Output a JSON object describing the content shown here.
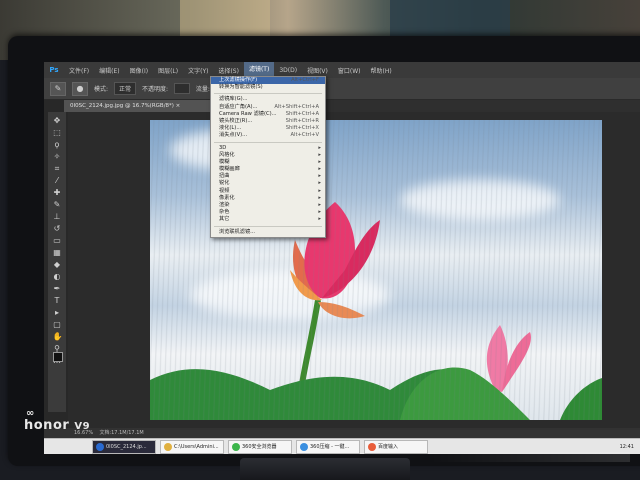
{
  "app": {
    "logo": "Ps"
  },
  "menubar": {
    "items": [
      "文件(F)",
      "编辑(E)",
      "图像(I)",
      "图层(L)",
      "文字(Y)",
      "选择(S)",
      "滤镜(T)",
      "3D(D)",
      "视图(V)",
      "窗口(W)",
      "帮助(H)"
    ],
    "active_index": 6
  },
  "options": {
    "mode_label": "模式:",
    "mode_value": "正常",
    "opacity_label": "不透明度:",
    "flow_label": "流量:"
  },
  "document": {
    "tab_label": "0I0SC_2124.jpg.jpg @ 16.7%(RGB/8*) ×"
  },
  "filter_menu": {
    "items": [
      {
        "label": "上次滤镜操作(F)",
        "shortcut": "Alt+Ctrl+F"
      },
      {
        "label": "转换为智能滤镜(S)",
        "shortcut": ""
      },
      {
        "sep": true
      },
      {
        "label": "滤镜库(G)...",
        "shortcut": ""
      },
      {
        "label": "自适应广角(A)...",
        "shortcut": "Alt+Shift+Ctrl+A"
      },
      {
        "label": "Camera Raw 滤镜(C)...",
        "shortcut": "Shift+Ctrl+A"
      },
      {
        "label": "镜头校正(R)...",
        "shortcut": "Shift+Ctrl+R"
      },
      {
        "label": "液化(L)...",
        "shortcut": "Shift+Ctrl+X"
      },
      {
        "label": "消失点(V)...",
        "shortcut": "Alt+Ctrl+V"
      },
      {
        "sep": true
      },
      {
        "label": "3D",
        "arrow": true
      },
      {
        "label": "风格化",
        "arrow": true
      },
      {
        "label": "模糊",
        "arrow": true
      },
      {
        "label": "模糊画廊",
        "arrow": true
      },
      {
        "label": "扭曲",
        "arrow": true
      },
      {
        "label": "锐化",
        "arrow": true
      },
      {
        "label": "视频",
        "arrow": true
      },
      {
        "label": "像素化",
        "arrow": true
      },
      {
        "label": "渲染",
        "arrow": true
      },
      {
        "label": "杂色",
        "arrow": true
      },
      {
        "label": "其它",
        "arrow": true
      },
      {
        "sep": true
      },
      {
        "label": "浏览联机滤镜...",
        "shortcut": ""
      }
    ]
  },
  "status": {
    "zoom": "16.67%",
    "doc_size": "文档:17.1M/17.1M"
  },
  "taskbar": {
    "items": [
      {
        "label": "0I0SC_2124.jp...",
        "color": "#2a6ad0"
      },
      {
        "label": "C:\\Users\\Admini...",
        "color": "#e0b040"
      },
      {
        "label": "360安全浏览器",
        "color": "#3bb54a"
      },
      {
        "label": "360压缩 - 一键...",
        "color": "#3a8fe0"
      },
      {
        "label": "百度输入",
        "color": "#e85d3a"
      }
    ],
    "clock": "12:41"
  },
  "watermark": {
    "brand": "honor",
    "model": "V9"
  }
}
